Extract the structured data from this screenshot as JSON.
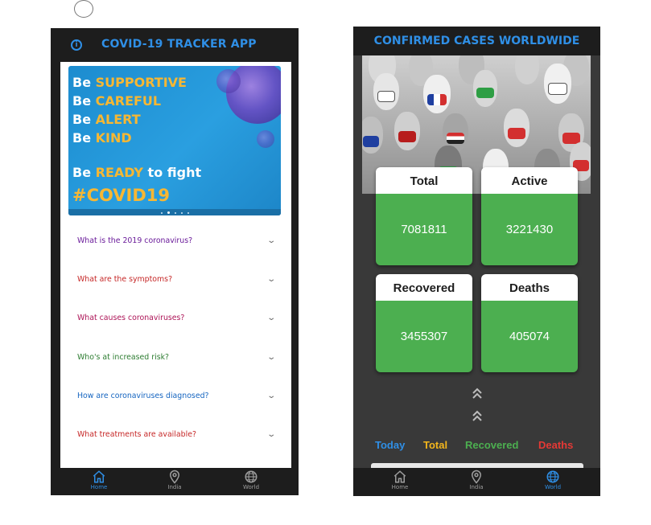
{
  "phone1": {
    "title": "COVID-19 TRACKER APP",
    "banner": {
      "lines": [
        {
          "prefix": "Be",
          "word": "SUPPORTIVE"
        },
        {
          "prefix": "Be",
          "word": "CAREFUL"
        },
        {
          "prefix": "Be",
          "word": "ALERT"
        },
        {
          "prefix": "Be",
          "word": "KIND"
        }
      ],
      "fight_prefix": "Be",
      "fight_word": "READY",
      "fight_suffix": "to fight",
      "hashtag": "#COVID19"
    },
    "faq": [
      {
        "question": "What is the 2019 coronavirus?",
        "color": "#6a1b9a"
      },
      {
        "question": "What are the symptoms?",
        "color": "#c62828"
      },
      {
        "question": "What causes coronaviruses?",
        "color": "#ad1457"
      },
      {
        "question": "Who's at increased risk?",
        "color": "#2e7d32"
      },
      {
        "question": "How are coronaviruses diagnosed?",
        "color": "#1565c0"
      },
      {
        "question": "What treatments are available?",
        "color": "#c62828"
      }
    ],
    "nav": [
      {
        "label": "Home",
        "icon": "home-icon",
        "active": true
      },
      {
        "label": "India",
        "icon": "location-pin-icon",
        "active": false
      },
      {
        "label": "World",
        "icon": "globe-icon",
        "active": false
      }
    ]
  },
  "phone2": {
    "title": "CONFIRMED CASES WORLDWIDE",
    "cards": [
      {
        "label": "Total",
        "value": "7081811"
      },
      {
        "label": "Active",
        "value": "3221430"
      },
      {
        "label": "Recovered",
        "value": "3455307"
      },
      {
        "label": "Deaths",
        "value": "405074"
      }
    ],
    "tabs": [
      {
        "label": "Today",
        "color": "#2f8fe6"
      },
      {
        "label": "Total",
        "color": "#f2b51c"
      },
      {
        "label": "Recovered",
        "color": "#4caf50"
      },
      {
        "label": "Deaths",
        "color": "#e53935"
      }
    ],
    "nav": [
      {
        "label": "Home",
        "icon": "home-icon",
        "active": false
      },
      {
        "label": "India",
        "icon": "location-pin-icon",
        "active": false
      },
      {
        "label": "World",
        "icon": "globe-icon",
        "active": true
      }
    ]
  },
  "colors": {
    "accent_blue": "#2f8fe6",
    "card_green": "#4caf50",
    "dark_bg": "#1d1d1d"
  }
}
